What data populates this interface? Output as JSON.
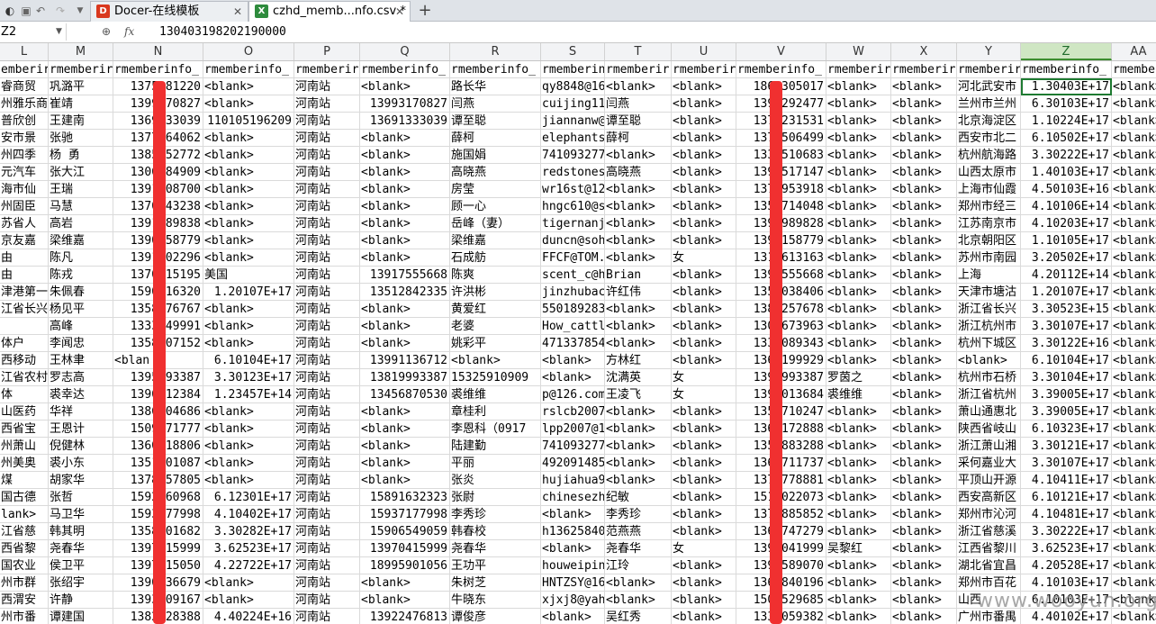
{
  "titlebar": {
    "icons": [
      "app-logo-icon",
      "save-icon",
      "undo-icon",
      "redo-icon",
      "dropdown-icon"
    ],
    "tabs": [
      {
        "label": "Docer-在线模板",
        "icon_letter": "D",
        "icon_color": "#d9381e",
        "active": false
      },
      {
        "label": "czhd_memb...nfo.csv *",
        "icon_letter": "X",
        "icon_color": "#2e8b3d",
        "active": true
      }
    ],
    "add_tab": "+"
  },
  "formula_bar": {
    "cell_ref": "Z2",
    "fx_label": "fx",
    "value": "130403198202190000"
  },
  "columns": [
    "L",
    "M",
    "N",
    "O",
    "P",
    "Q",
    "R",
    "S",
    "T",
    "U",
    "V",
    "W",
    "X",
    "Y",
    "Z",
    "AA"
  ],
  "selected_column": "Z",
  "header_row": [
    "emberir",
    "rmemberir",
    "rmemberinfo_",
    "rmemberinfo_",
    "rmemberir",
    "rmemberinfo_",
    "rmemberinfo_",
    "rmemberinfo_",
    "rmemberir",
    "rmemberir",
    "rmemberinfo_",
    "rmemberir",
    "rmemberir",
    "rmemberir",
    "rmemberinfo_",
    "rmemberir"
  ],
  "rows": [
    [
      "睿商贸",
      "巩潞平",
      "1375   81220",
      "<blank>",
      "河南站",
      "<blank>",
      "路长华",
      "qy8848@16",
      "<blank>",
      "<blank>",
      "186    305017",
      "<blank>",
      "<blank>",
      "河北武安市",
      "1.30403E+17",
      "<blank>"
    ],
    [
      "州雅乐商",
      "崔靖",
      "1399   70827",
      "<blank>",
      "河南站",
      "13993170827",
      "闫燕",
      "cuijing11",
      "闫燕",
      "<blank>",
      "139    292477",
      "<blank>",
      "<blank>",
      "兰州市兰州",
      "6.30103E+17",
      "<blank>"
    ],
    [
      "普欣创",
      "王建南",
      "1369   33039",
      "110105196209",
      "河南站",
      "13691333039",
      "谭至聪",
      "jiannanw@",
      "谭至聪",
      "<blank>",
      "137    231531",
      "<blank>",
      "<blank>",
      "北京海淀区",
      "1.10224E+17",
      "<blank>"
    ],
    [
      "安市景",
      "张驰",
      "1377   64062",
      "<blank>",
      "河南站",
      "<blank>",
      "薛柯",
      "elephants",
      "薛柯",
      "<blank>",
      "137    506499",
      "<blank>",
      "<blank>",
      "西安市北二",
      "6.10502E+17",
      "<blank>"
    ],
    [
      "州四季",
      "杨 勇",
      "1385   52772",
      "<blank>",
      "河南站",
      "<blank>",
      "施国娟",
      "741093277",
      "<blank>",
      "<blank>",
      "133    510683",
      "<blank>",
      "<blank>",
      "杭州航海路",
      "3.30222E+17",
      "<blank>"
    ],
    [
      "元汽车",
      "张大江",
      "1306   84909",
      "<blank>",
      "河南站",
      "<blank>",
      "高晓燕",
      "redstones",
      "高晓燕",
      "<blank>",
      "139    517147",
      "<blank>",
      "<blank>",
      "山西太原市",
      "1.40103E+17",
      "<blank>"
    ],
    [
      "海市仙",
      "王瑞",
      "1391   08700",
      "<blank>",
      "河南站",
      "<blank>",
      "房莹",
      "wr16st@12",
      "<blank>",
      "<blank>",
      "137    953918",
      "<blank>",
      "<blank>",
      "上海市仙霞",
      "4.50103E+16",
      "<blank>"
    ],
    [
      "州固臣",
      "马慧",
      "1370   43238",
      "<blank>",
      "河南站",
      "<blank>",
      "顾一心",
      "hngc610@s",
      "<blank>",
      "<blank>",
      "135    714048",
      "<blank>",
      "<blank>",
      "郑州市经三",
      "4.10106E+14",
      "<blank>"
    ],
    [
      "苏省人",
      "高岩",
      "1391   89838",
      "<blank>",
      "河南站",
      "<blank>",
      "岳峰（妻）",
      "tigernanj",
      "<blank>",
      "<blank>",
      "139    989828",
      "<blank>",
      "<blank>",
      "江苏南京市",
      "4.10203E+17",
      "<blank>"
    ],
    [
      "京友嘉",
      "梁维嘉",
      "1390   58779",
      "<blank>",
      "河南站",
      "<blank>",
      "梁维嘉",
      "duncn@soh",
      "<blank>",
      "<blank>",
      "139    158779",
      "<blank>",
      "<blank>",
      "北京朝阳区",
      "1.10105E+17",
      "<blank>"
    ],
    [
      "由",
      "陈凡",
      "1391   02296",
      "<blank>",
      "河南站",
      "<blank>",
      "石成舫",
      "FFCF@TOM.",
      "<blank>",
      "女",
      "131    613163",
      "<blank>",
      "<blank>",
      "苏州市南园",
      "3.20502E+17",
      "<blank>"
    ],
    [
      "由",
      "陈戎",
      "1370   15195",
      "美国",
      "河南站",
      "13917555668",
      "陈爽",
      "scent_c@h",
      "Brian",
      "<blank>",
      "139    555668",
      "<blank>",
      "<blank>",
      "上海",
      "4.20112E+14",
      "<blank>"
    ],
    [
      "津港第一",
      "朱佩春",
      "1590   16320",
      "1.20107E+17",
      "河南站",
      "13512842335",
      "许洪彬",
      "jinzhubac",
      "许红伟",
      "<blank>",
      "135    038406",
      "<blank>",
      "<blank>",
      "天津市塘沽",
      "1.20107E+17",
      "<blank>"
    ],
    [
      "江省长兴",
      "杨见平",
      "1358   76767",
      "<blank>",
      "河南站",
      "<blank>",
      "黄爱红",
      "550189283",
      "<blank>",
      "<blank>",
      "138    257678",
      "<blank>",
      "<blank>",
      "浙江省长兴",
      "3.30523E+15",
      "<blank>"
    ],
    [
      "",
      "高峰",
      "1333   49991",
      "<blank>",
      "河南站",
      "<blank>",
      "老婆",
      "How_cattl",
      "<blank>",
      "<blank>",
      "130    673963",
      "<blank>",
      "<blank>",
      "浙江杭州市",
      "3.30107E+17",
      "<blank>"
    ],
    [
      "体户",
      "李闻忠",
      "1358   07152",
      "<blank>",
      "河南站",
      "<blank>",
      "姚彩平",
      "471337854",
      "<blank>",
      "<blank>",
      "133    089343",
      "<blank>",
      "<blank>",
      "杭州下城区",
      "3.30122E+16",
      "<blank>"
    ],
    [
      "西移动",
      "王林聿",
      "<blan",
      "6.10104E+17",
      "河南站",
      "13991136712",
      "<blank>",
      "<blank>",
      "方林红",
      "<blank>",
      "136    199929",
      "<blank>",
      "<blank>",
      "<blank>",
      "6.10104E+17",
      "<blank>"
    ],
    [
      "江省农村",
      "罗志高",
      "1395   93387",
      "3.30123E+17",
      "河南站",
      "13819993387",
      "15325910909",
      "<blank>",
      "沈满英",
      "女",
      "139    993387",
      "罗茵之",
      "<blank>",
      "杭州市石桥",
      "3.30104E+17",
      "<blank>"
    ],
    [
      "体",
      "裘幸达",
      "1396   12384",
      "1.23457E+14",
      "河南站",
      "13456870530",
      "裘维维",
      "p@126.com",
      "王凌飞",
      "女",
      "139    013684",
      "裘维维",
      "<blank>",
      "浙江省杭州",
      "3.39005E+17",
      "<blank>"
    ],
    [
      "山医药",
      "华祥",
      "1386   04686",
      "<blank>",
      "河南站",
      "<blank>",
      "章桂利",
      "rslcb2007",
      "<blank>",
      "<blank>",
      "135    710247",
      "<blank>",
      "<blank>",
      "萧山通惠北",
      "3.39005E+17",
      "<blank>"
    ],
    [
      "西省宝",
      "王恩计",
      "1509   71777",
      "<blank>",
      "河南站",
      "<blank>",
      "李恩科（0917",
      "lpp2007@1",
      "<blank>",
      "<blank>",
      "136    172888",
      "<blank>",
      "<blank>",
      "陕西省岐山",
      "6.10323E+17",
      "<blank>"
    ],
    [
      "州萧山",
      "倪健林",
      "1360   18806",
      "<blank>",
      "河南站",
      "<blank>",
      "陆建勤",
      "741093277",
      "<blank>",
      "<blank>",
      "135    883288",
      "<blank>",
      "<blank>",
      "浙江萧山湘",
      "3.30121E+17",
      "<blank>"
    ],
    [
      "州美奥",
      "裘小东",
      "1351   01087",
      "<blank>",
      "河南站",
      "<blank>",
      "平丽",
      "492091485",
      "<blank>",
      "<blank>",
      "136    711737",
      "<blank>",
      "<blank>",
      "采何嘉业大",
      "3.30107E+17",
      "<blank>"
    ],
    [
      "煤",
      "胡家华",
      "1378   57805",
      "<blank>",
      "河南站",
      "<blank>",
      "张炎",
      "hujiahua9",
      "<blank>",
      "<blank>",
      "137    778881",
      "<blank>",
      "<blank>",
      "平顶山开源",
      "4.10411E+17",
      "<blank>"
    ],
    [
      "国古德",
      "张哲",
      "1592   60968",
      "6.12301E+17",
      "河南站",
      "15891632323",
      "张尉",
      "chinesezh",
      "纪敏",
      "<blank>",
      "151    022073",
      "<blank>",
      "<blank>",
      "西安高新区",
      "6.10121E+17",
      "<blank>"
    ],
    [
      "lank>",
      "马卫华",
      "1593   77998",
      "4.10402E+17",
      "河南站",
      "15937177998",
      "李秀珍",
      "<blank>",
      "李秀珍",
      "<blank>",
      "137    885852",
      "<blank>",
      "<blank>",
      "郑州市沁河",
      "4.10481E+17",
      "<blank>"
    ],
    [
      "江省慈",
      "韩其明",
      "1358   01682",
      "3.30282E+17",
      "河南站",
      "15906549059",
      "韩春校",
      "h13625840",
      "范燕燕",
      "<blank>",
      "136    747279",
      "<blank>",
      "<blank>",
      "浙江省慈溪",
      "3.30222E+17",
      "<blank>"
    ],
    [
      "西省黎",
      "尧春华",
      "1397   15999",
      "3.62523E+17",
      "河南站",
      "13970415999",
      "尧春华",
      "<blank>",
      "尧春华",
      "女",
      "139    041999",
      "吴黎红",
      "<blank>",
      "江西省黎川",
      "3.62523E+17",
      "<blank>"
    ],
    [
      "国农业",
      "侯卫平",
      "1397   15050",
      "4.22722E+17",
      "河南站",
      "18995901056",
      "王功平",
      "houweipin",
      "江玲",
      "<blank>",
      "139    589070",
      "<blank>",
      "<blank>",
      "湖北省宜昌",
      "4.20528E+17",
      "<blank>"
    ],
    [
      "州市群",
      "张绍宇",
      "1390   36679",
      "<blank>",
      "河南站",
      "<blank>",
      "朱树芝",
      "HNTZSY@16",
      "<blank>",
      "<blank>",
      "136    840196",
      "<blank>",
      "<blank>",
      "郑州市百花",
      "4.10103E+17",
      "<blank>"
    ],
    [
      "西渭安",
      "许静",
      "1393   09167",
      "<blank>",
      "河南站",
      "<blank>",
      "牛晓东",
      "xjxj8@yah",
      "<blank>",
      "<blank>",
      "150    529685",
      "<blank>",
      "<blank>",
      "山西",
      "6.10103E+17",
      "<blank>"
    ],
    [
      "州市番",
      "谭建国",
      "1382   28388",
      "4.40224E+16",
      "河南站",
      "13922476813",
      "谭俊彦",
      "<blank>",
      "吴红秀",
      "<blank>",
      "133    059382",
      "<blank>",
      "<blank>",
      "广州市番禺",
      "4.40102E+17",
      "<blank>"
    ]
  ],
  "watermark": "www.wooyun.org"
}
